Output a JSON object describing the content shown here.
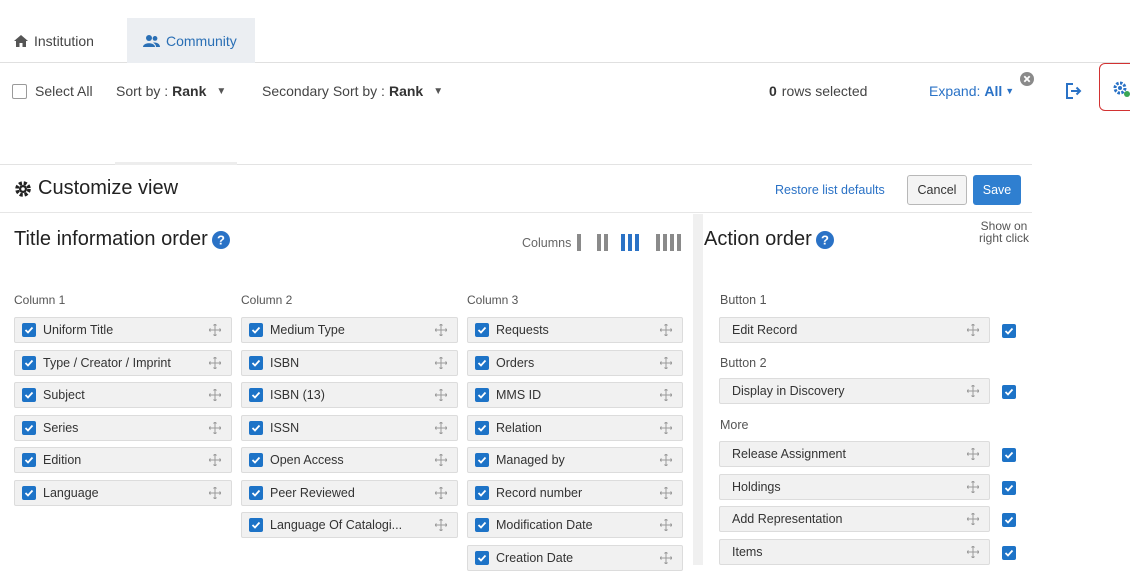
{
  "tabs": [
    {
      "label": "Institution",
      "icon": "home-icon",
      "active": false
    },
    {
      "label": "Community",
      "icon": "users-icon",
      "active": true
    }
  ],
  "toolbar": {
    "select_all": "Select All",
    "sort_label": "Sort by :",
    "sort_value": "Rank",
    "secondary_sort_label": "Secondary Sort by :",
    "secondary_sort_value": "Rank",
    "rows_selected_count": "0",
    "rows_selected_text": "rows selected",
    "expand_label": "Expand:",
    "expand_value": "All"
  },
  "customize": {
    "title": "Customize view",
    "restore_link": "Restore list defaults",
    "cancel": "Cancel",
    "save": "Save"
  },
  "title_section": {
    "title": "Title information order",
    "columns_label": "Columns",
    "active_columns": 3,
    "column_headers": [
      "Column 1",
      "Column 2",
      "Column 3"
    ],
    "column1": [
      "Uniform Title",
      "Type / Creator / Imprint",
      "Subject",
      "Series",
      "Edition",
      "Language"
    ],
    "column2": [
      "Medium Type",
      "ISBN",
      "ISBN (13)",
      "ISSN",
      "Open Access",
      "Peer Reviewed",
      "Language Of Catalogi..."
    ],
    "column3": [
      "Requests",
      "Orders",
      "MMS ID",
      "Relation",
      "Managed by",
      "Record number",
      "Modification Date",
      "Creation Date"
    ]
  },
  "action_section": {
    "title": "Action order",
    "show_right_click": "Show on right click",
    "button1_label": "Button 1",
    "button1_item": "Edit Record",
    "button2_label": "Button 2",
    "button2_item": "Display in Discovery",
    "more_label": "More",
    "more_items": [
      "Release Assignment",
      "Holdings",
      "Add Representation",
      "Items"
    ]
  },
  "colors": {
    "accent": "#2a72c6",
    "checkbox": "#1d73c7",
    "save_button": "#2f7fd0",
    "highlight": "#d23232",
    "settings_icon_green": "#3aa655"
  }
}
